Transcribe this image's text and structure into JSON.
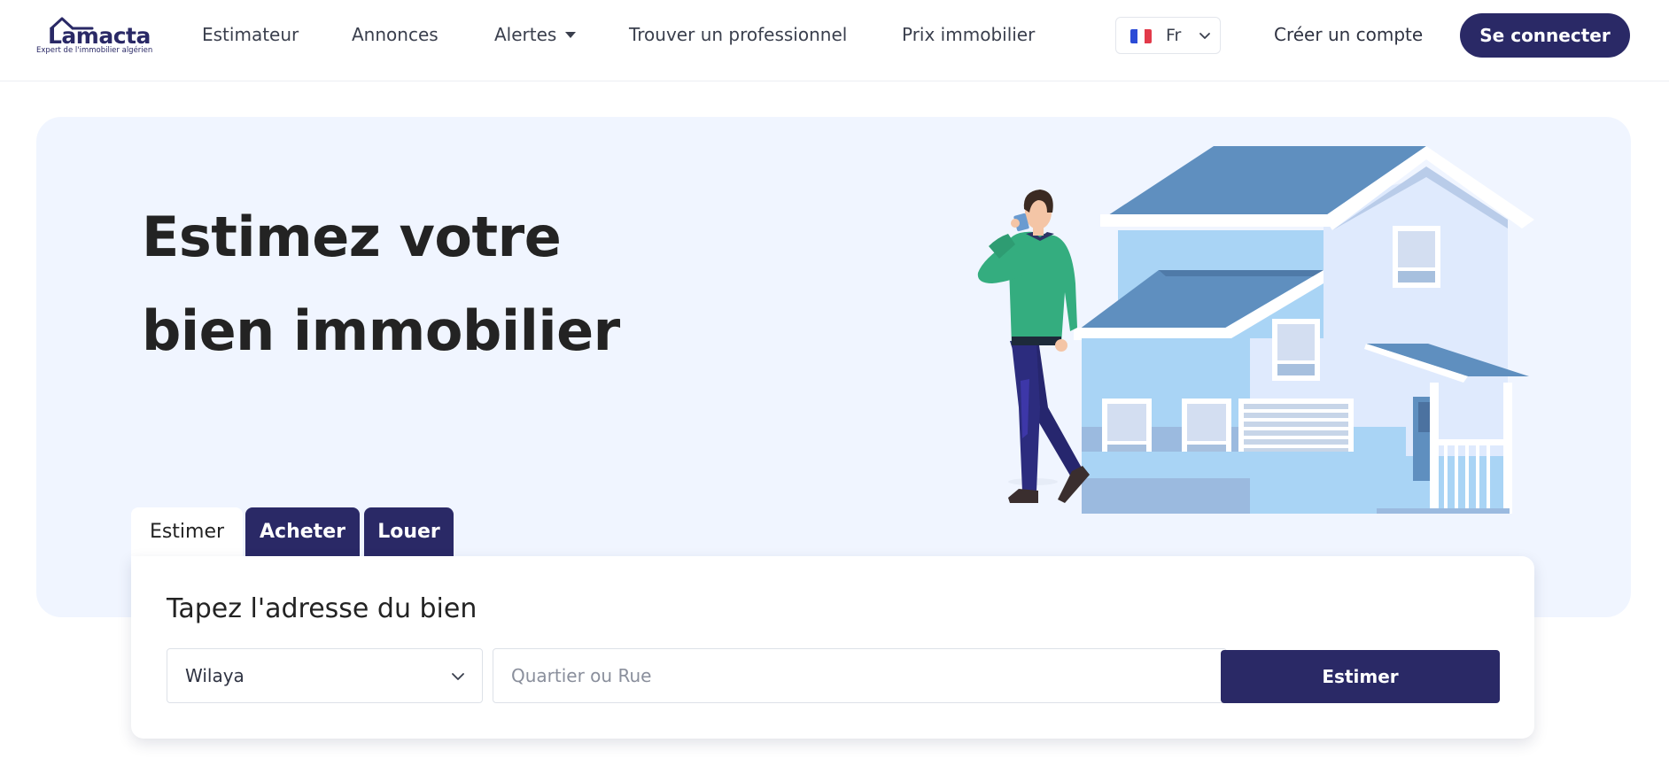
{
  "header": {
    "logo": {
      "wordmark": "Lamacta",
      "tagline": "Expert de l'immobilier algérien"
    },
    "nav": {
      "estimateur": "Estimateur",
      "annonces": "Annonces",
      "alertes": "Alertes",
      "trouver_pro": "Trouver un professionnel",
      "prix": "Prix immobilier"
    },
    "language": {
      "code": "Fr",
      "flag_icon": "france-flag-icon",
      "flag_colors": [
        "#2b4bd6",
        "#ffffff",
        "#e23a4a"
      ]
    },
    "register_label": "Créer un compte",
    "login_label": "Se connecter"
  },
  "hero": {
    "title_line1": "Estimez votre",
    "title_line2": "bien immobilier",
    "illustration": "man-on-phone-with-house-illustration"
  },
  "tabs": [
    {
      "label": "Estimer",
      "active": true
    },
    {
      "label": "Acheter",
      "active": false
    },
    {
      "label": "Louer",
      "active": false
    }
  ],
  "search": {
    "title": "Tapez l'adresse du bien",
    "wilaya_value": "Wilaya",
    "street_placeholder": "Quartier ou Rue",
    "submit_label": "Estimer"
  },
  "colors": {
    "brand": "#2a2966",
    "hero_background": "#f0f5ff",
    "house_roof": "#5f8fbf",
    "house_wall": "#a9d4f5",
    "shirt": "#34ad7f"
  }
}
